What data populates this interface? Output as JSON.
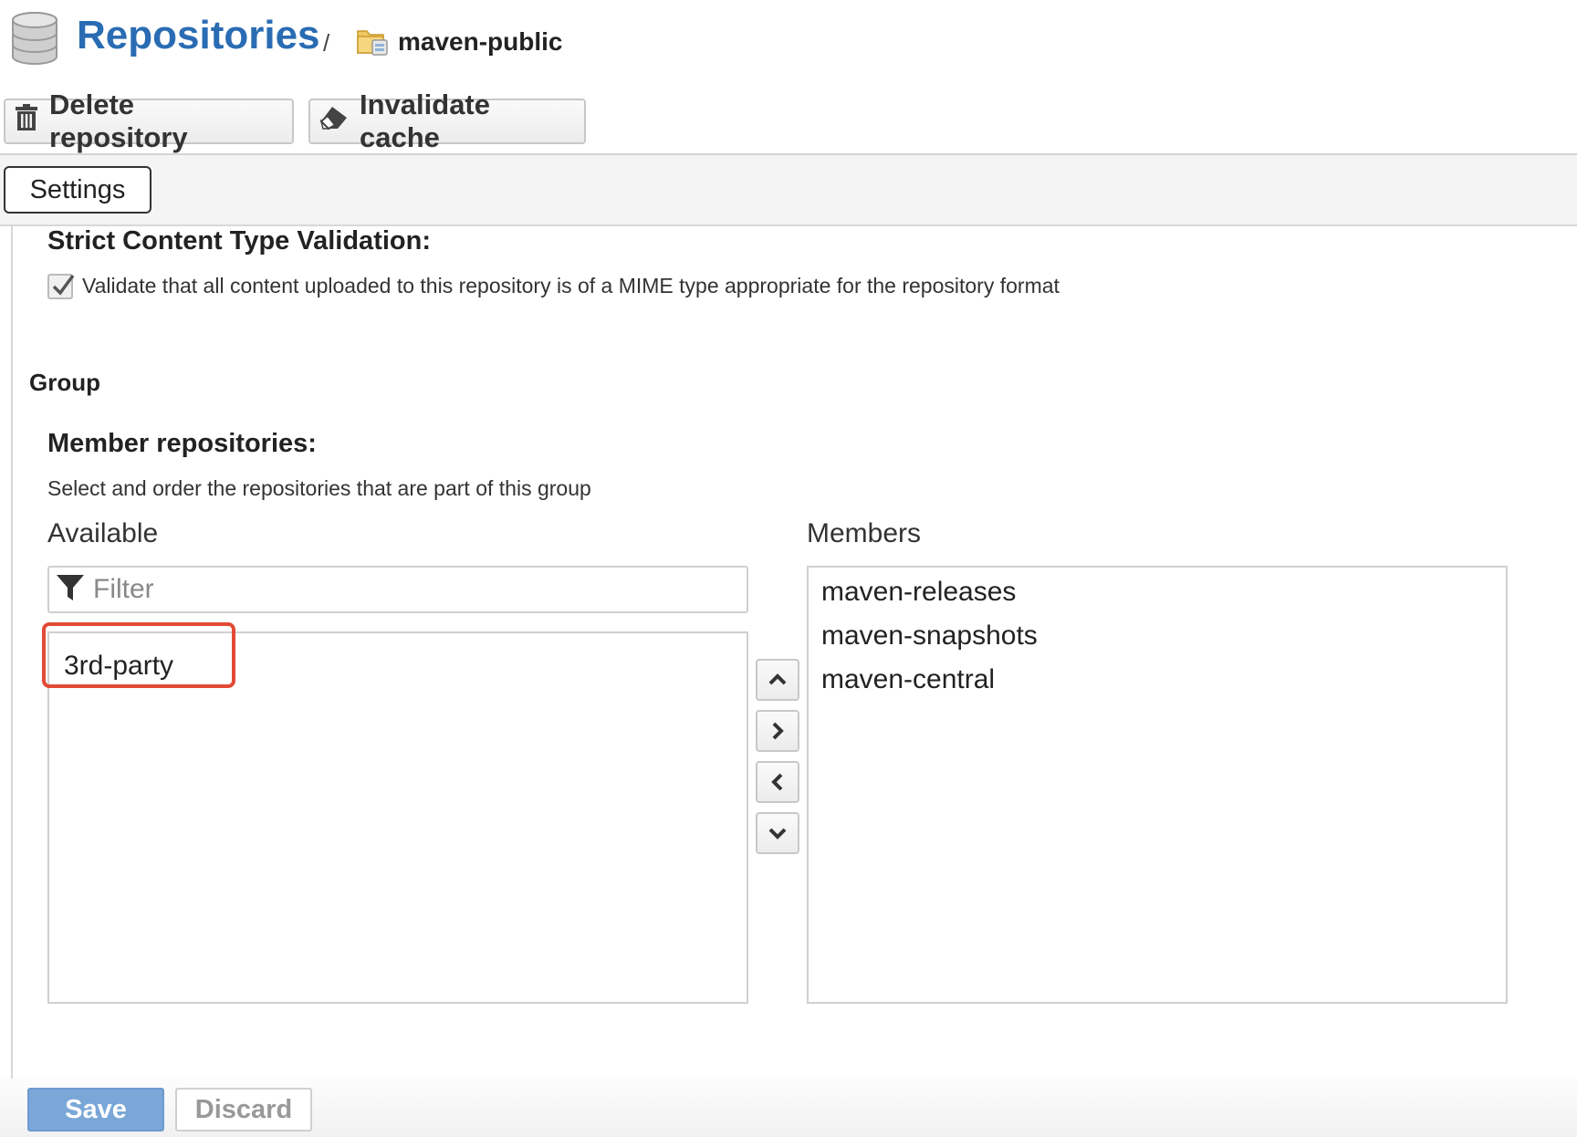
{
  "breadcrumb": {
    "root_icon": "database-icon",
    "root_label": "Repositories",
    "separator": "/",
    "current_icon": "folder-group-icon",
    "current_label": "maven-public"
  },
  "toolbar": {
    "delete_icon": "trash-icon",
    "delete_label": "Delete repository",
    "invalidate_icon": "eraser-icon",
    "invalidate_label": "Invalidate cache"
  },
  "tabs": [
    {
      "label": "Settings",
      "active": true
    }
  ],
  "strict_validation": {
    "heading": "Strict Content Type Validation:",
    "checkbox_label": "Validate that all content uploaded to this repository is of a MIME type appropriate for the repository format",
    "checked": true
  },
  "group": {
    "section_title": "Group",
    "member_heading": "Member repositories:",
    "description": "Select and order the repositories that are part of this group",
    "available_label": "Available",
    "members_label": "Members",
    "filter_icon": "filter-icon",
    "filter_placeholder": "Filter",
    "available_items": [
      "3rd-party"
    ],
    "highlighted_item": "3rd-party",
    "highlight_color": "#e24a35",
    "members_items": [
      "maven-releases",
      "maven-snapshots",
      "maven-central"
    ],
    "move_buttons": [
      "chevron-up-icon",
      "chevron-right-icon",
      "chevron-left-icon",
      "chevron-down-icon"
    ]
  },
  "footer": {
    "save_label": "Save",
    "discard_label": "Discard"
  },
  "colors": {
    "title_blue": "#2a6cb3",
    "save_blue": "#7aa7d8"
  }
}
